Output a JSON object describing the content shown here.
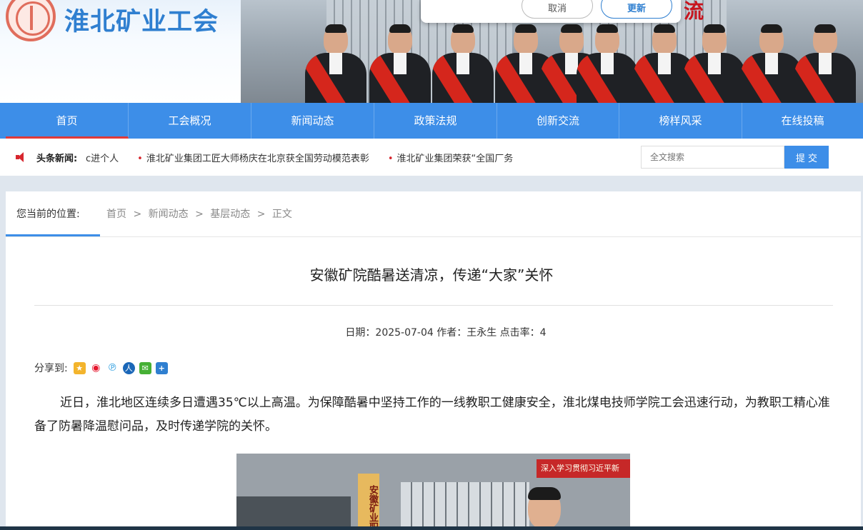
{
  "header": {
    "site_title": "淮北矿业工会",
    "banner_text": "流"
  },
  "dialog": {
    "cancel_label": "取消",
    "update_label": "更新"
  },
  "nav": {
    "items": [
      "首页",
      "工会概况",
      "新闻动态",
      "政策法规",
      "创新交流",
      "榜样风采",
      "在线投稿"
    ],
    "active_index": 0
  },
  "headline": {
    "label": "头条新闻:",
    "items": [
      "c进个人",
      "淮北矿业集团工匠大师杨庆在北京获全国劳动模范表彰",
      "淮北矿业集团荣获“全国厂务"
    ]
  },
  "search": {
    "placeholder": "全文搜索",
    "button_label": "提 交"
  },
  "breadcrumb": {
    "label": "您当前的位置:",
    "path": [
      "首页",
      ">",
      "新闻动态",
      ">",
      "基层动态",
      ">",
      "正文"
    ]
  },
  "article": {
    "title": "安徽矿院酷暑送清凉，传递“大家”关怀",
    "meta": "日期：2025-07-04 作者：王永生 点击率：4",
    "share_label": "分享到:",
    "paragraph": "近日，淮北地区连续多日遭遇35℃以上高温。为保障酷暑中坚持工作的一线教职工健康安全，淮北煤电技师学院工会迅速行动，为教职工精心准备了防暑降温慰问品，及时传递学院的关怀。",
    "photo_sign": "安徽矿业职",
    "photo_banner": "深入学习贯彻习近平新"
  },
  "colors": {
    "nav_blue": "#3d8ee8",
    "accent_red": "#e03a3a",
    "logo_blue": "#2f7fd0"
  },
  "share_icons": [
    "qzone-icon",
    "weibo-icon",
    "pengyou-icon",
    "renren-icon",
    "wechat-icon",
    "more-icon"
  ]
}
